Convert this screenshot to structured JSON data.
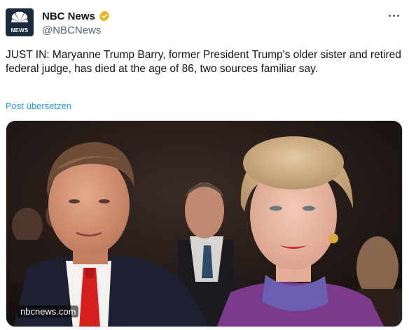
{
  "account": {
    "avatar_text": "NEWS",
    "display_name": "NBC News",
    "handle": "@NBCNews",
    "verified_icon": "gold-verified-badge-icon"
  },
  "post": {
    "text": "JUST IN: Maryanne Trump Barry, former President Trump's older sister and retired federal judge, has died at the age of 86, two sources familiar say.",
    "translate_label": "Post übersetzen"
  },
  "media": {
    "source_label": "nbcnews.com"
  },
  "colors": {
    "link": "#1d9bf0",
    "text": "#0f1419",
    "muted": "#536471",
    "verified_gold": "#e2b719"
  }
}
